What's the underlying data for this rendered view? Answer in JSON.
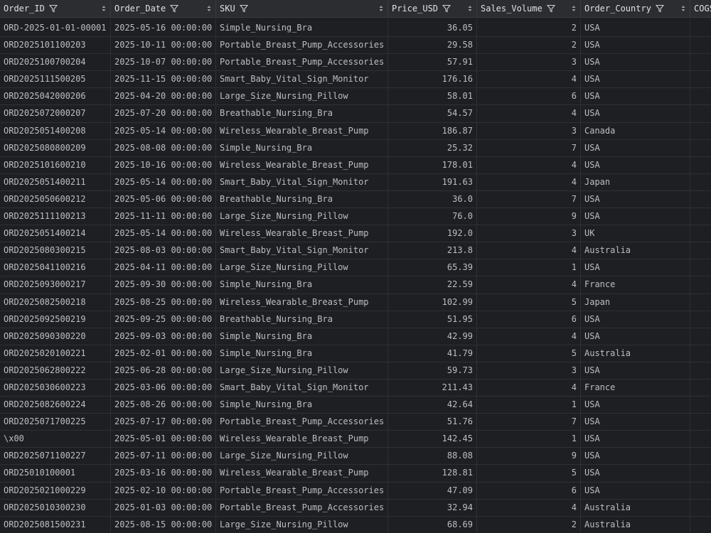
{
  "columns": [
    {
      "label": "Order_ID",
      "filter": true,
      "sort": true
    },
    {
      "label": "Order_Date",
      "filter": true,
      "sort": true
    },
    {
      "label": "SKU",
      "filter": true,
      "sort": true
    },
    {
      "label": "Price_USD",
      "filter": true,
      "sort": true
    },
    {
      "label": "Sales_Volume",
      "filter": true,
      "sort": true
    },
    {
      "label": "Order_Country",
      "filter": true,
      "sort": true
    },
    {
      "label": "COGS",
      "filter": false,
      "sort": false
    }
  ],
  "rows": [
    [
      "ORD-2025-01-01-00001",
      "2025-05-16 00:00:00",
      "Simple_Nursing_Bra",
      "36.05",
      "2",
      "USA"
    ],
    [
      "ORD2025101100203",
      "2025-10-11 00:00:00",
      "Portable_Breast_Pump_Accessories",
      "29.58",
      "2",
      "USA"
    ],
    [
      "ORD2025100700204",
      "2025-10-07 00:00:00",
      "Portable_Breast_Pump_Accessories",
      "57.91",
      "3",
      "USA"
    ],
    [
      "ORD2025111500205",
      "2025-11-15 00:00:00",
      "Smart_Baby_Vital_Sign_Monitor",
      "176.16",
      "4",
      "USA"
    ],
    [
      "ORD2025042000206",
      "2025-04-20 00:00:00",
      "Large_Size_Nursing_Pillow",
      "58.01",
      "6",
      "USA"
    ],
    [
      "ORD2025072000207",
      "2025-07-20 00:00:00",
      "Breathable_Nursing_Bra",
      "54.57",
      "4",
      "USA"
    ],
    [
      "ORD2025051400208",
      "2025-05-14 00:00:00",
      "Wireless_Wearable_Breast_Pump",
      "186.87",
      "3",
      "Canada"
    ],
    [
      "ORD2025080800209",
      "2025-08-08 00:00:00",
      "Simple_Nursing_Bra",
      "25.32",
      "7",
      "USA"
    ],
    [
      "ORD2025101600210",
      "2025-10-16 00:00:00",
      "Wireless_Wearable_Breast_Pump",
      "178.01",
      "4",
      "USA"
    ],
    [
      "ORD2025051400211",
      "2025-05-14 00:00:00",
      "Smart_Baby_Vital_Sign_Monitor",
      "191.63",
      "4",
      "Japan"
    ],
    [
      "ORD2025050600212",
      "2025-05-06 00:00:00",
      "Breathable_Nursing_Bra",
      "36.0",
      "7",
      "USA"
    ],
    [
      "ORD2025111100213",
      "2025-11-11 00:00:00",
      "Large_Size_Nursing_Pillow",
      "76.0",
      "9",
      "USA"
    ],
    [
      "ORD2025051400214",
      "2025-05-14 00:00:00",
      "Wireless_Wearable_Breast_Pump",
      "192.0",
      "3",
      "UK"
    ],
    [
      "ORD2025080300215",
      "2025-08-03 00:00:00",
      "Smart_Baby_Vital_Sign_Monitor",
      "213.8",
      "4",
      "Australia"
    ],
    [
      "ORD2025041100216",
      "2025-04-11 00:00:00",
      "Large_Size_Nursing_Pillow",
      "65.39",
      "1",
      "USA"
    ],
    [
      "ORD2025093000217",
      "2025-09-30 00:00:00",
      "Simple_Nursing_Bra",
      "22.59",
      "4",
      "France"
    ],
    [
      "ORD2025082500218",
      "2025-08-25 00:00:00",
      "Wireless_Wearable_Breast_Pump",
      "102.99",
      "5",
      "Japan"
    ],
    [
      "ORD2025092500219",
      "2025-09-25 00:00:00",
      "Breathable_Nursing_Bra",
      "51.95",
      "6",
      "USA"
    ],
    [
      "ORD2025090300220",
      "2025-09-03 00:00:00",
      "Simple_Nursing_Bra",
      "42.99",
      "4",
      "USA"
    ],
    [
      "ORD2025020100221",
      "2025-02-01 00:00:00",
      "Simple_Nursing_Bra",
      "41.79",
      "5",
      "Australia"
    ],
    [
      "ORD2025062800222",
      "2025-06-28 00:00:00",
      "Large_Size_Nursing_Pillow",
      "59.73",
      "3",
      "USA"
    ],
    [
      "ORD2025030600223",
      "2025-03-06 00:00:00",
      "Smart_Baby_Vital_Sign_Monitor",
      "211.43",
      "4",
      "France"
    ],
    [
      "ORD2025082600224",
      "2025-08-26 00:00:00",
      "Simple_Nursing_Bra",
      "42.64",
      "1",
      "USA"
    ],
    [
      "ORD2025071700225",
      "2025-07-17 00:00:00",
      "Portable_Breast_Pump_Accessories",
      "51.76",
      "7",
      "USA"
    ],
    [
      "\\x00",
      "2025-05-01 00:00:00",
      "Wireless_Wearable_Breast_Pump",
      "142.45",
      "1",
      "USA"
    ],
    [
      "ORD2025071100227",
      "2025-07-11 00:00:00",
      "Large_Size_Nursing_Pillow",
      "88.08",
      "9",
      "USA"
    ],
    [
      "ORD25010100001",
      "2025-03-16 00:00:00",
      "Wireless_Wearable_Breast_Pump",
      "128.81",
      "5",
      "USA"
    ],
    [
      "ORD2025021000229",
      "2025-02-10 00:00:00",
      "Portable_Breast_Pump_Accessories",
      "47.09",
      "6",
      "USA"
    ],
    [
      "ORD2025010300230",
      "2025-01-03 00:00:00",
      "Portable_Breast_Pump_Accessories",
      "32.94",
      "4",
      "Australia"
    ],
    [
      "ORD2025081500231",
      "2025-08-15 00:00:00",
      "Large_Size_Nursing_Pillow",
      "68.69",
      "2",
      "Australia"
    ]
  ]
}
